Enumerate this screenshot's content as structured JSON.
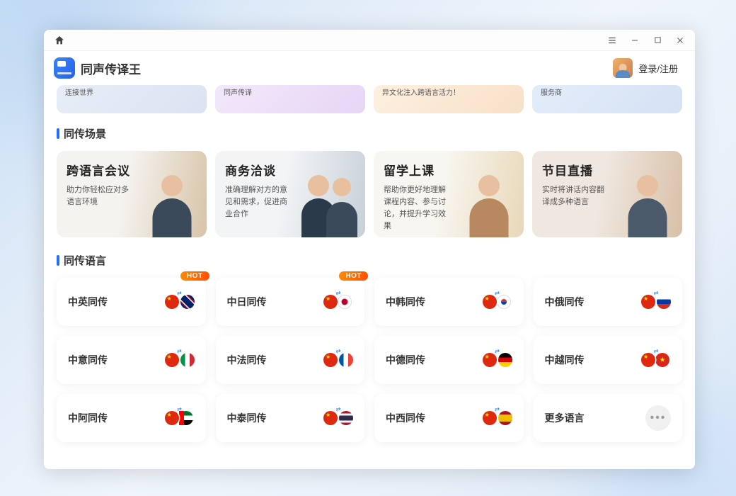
{
  "app": {
    "title": "同声传译王",
    "login": "登录/注册"
  },
  "top_partial": {
    "a": "连接世界",
    "b": "同声传译",
    "c": "异文化注入跨语言活力！",
    "d": "服务商"
  },
  "sections": {
    "scenes_title": "同传场景",
    "langs_title": "同传语言"
  },
  "scenes": [
    {
      "title": "跨语言会议",
      "desc": "助力你轻松应对多语言环境"
    },
    {
      "title": "商务洽谈",
      "desc": "准确理解对方的意见和需求，促进商业合作"
    },
    {
      "title": "留学上课",
      "desc": "帮助你更好地理解 课程内容、参与讨论，并提升学习效果"
    },
    {
      "title": "节目直播",
      "desc": "实时将讲话内容翻译成多种语言"
    }
  ],
  "langs": [
    {
      "label": "中英同传",
      "hot": true,
      "from": "cn",
      "to": "gb"
    },
    {
      "label": "中日同传",
      "hot": true,
      "from": "cn",
      "to": "jp"
    },
    {
      "label": "中韩同传",
      "hot": false,
      "from": "cn",
      "to": "kr"
    },
    {
      "label": "中俄同传",
      "hot": false,
      "from": "cn",
      "to": "ru"
    },
    {
      "label": "中意同传",
      "hot": false,
      "from": "cn",
      "to": "it"
    },
    {
      "label": "中法同传",
      "hot": false,
      "from": "cn",
      "to": "fr"
    },
    {
      "label": "中德同传",
      "hot": false,
      "from": "cn",
      "to": "de"
    },
    {
      "label": "中越同传",
      "hot": false,
      "from": "cn",
      "to": "vn"
    },
    {
      "label": "中阿同传",
      "hot": false,
      "from": "cn",
      "to": "ae"
    },
    {
      "label": "中泰同传",
      "hot": false,
      "from": "cn",
      "to": "th"
    },
    {
      "label": "中西同传",
      "hot": false,
      "from": "cn",
      "to": "es"
    }
  ],
  "more_label": "更多语言",
  "hot_label": "HOT"
}
